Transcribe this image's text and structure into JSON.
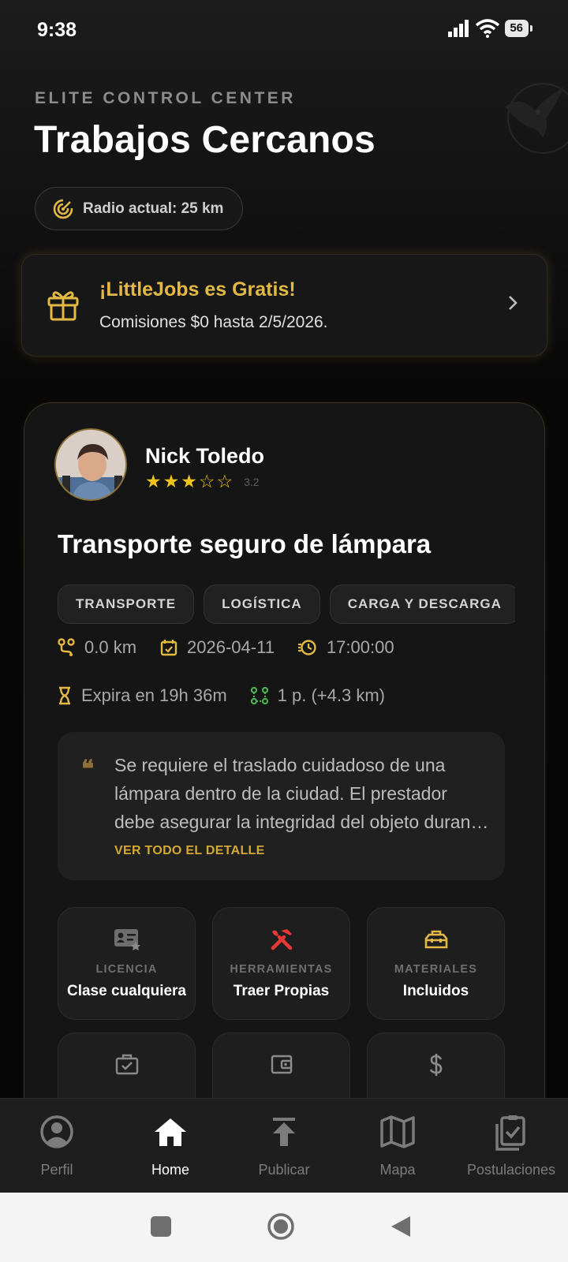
{
  "status_bar": {
    "time": "9:38",
    "battery": "56"
  },
  "header": {
    "eyebrow": "ELITE CONTROL CENTER",
    "title": "Trabajos Cercanos",
    "radius_label": "Radio actual: 25 km"
  },
  "promo": {
    "title": "¡LittleJobs es Gratis!",
    "subtitle": "Comisiones $0 hasta 2/5/2026."
  },
  "job": {
    "author": "Nick Toledo",
    "rating": 3.2,
    "rating_label": "3.2",
    "title": "Transporte seguro de lámpara",
    "tags": [
      "TRANSPORTE",
      "LOGÍSTICA",
      "CARGA Y DESCARGA"
    ],
    "distance": "0.0 km",
    "date": "2026-04-11",
    "time": "17:00:00",
    "expires": "Expira en 19h 36m",
    "stops": "1 p. (+4.3 km)",
    "description": "Se requiere el traslado cuidadoso de una lámpara dentro de la ciudad. El prestador debe asegurar la integridad del objeto durante todo el trayecto.",
    "see_more": "VER TODO EL DETALLE",
    "requirements": [
      {
        "label": "LICENCIA",
        "value": "Clase cualquiera"
      },
      {
        "label": "HERRAMIENTAS",
        "value": "Traer Propias"
      },
      {
        "label": "MATERIALES",
        "value": "Incluidos"
      }
    ]
  },
  "nav": {
    "items": [
      {
        "label": "Perfil"
      },
      {
        "label": "Home"
      },
      {
        "label": "Publicar"
      },
      {
        "label": "Mapa"
      },
      {
        "label": "Postulaciones"
      }
    ],
    "active": "Home"
  },
  "colors": {
    "accent": "#e3b944",
    "background": "#0a0a0a",
    "card": "#151515",
    "green": "#4caf50",
    "red": "#e53935"
  }
}
